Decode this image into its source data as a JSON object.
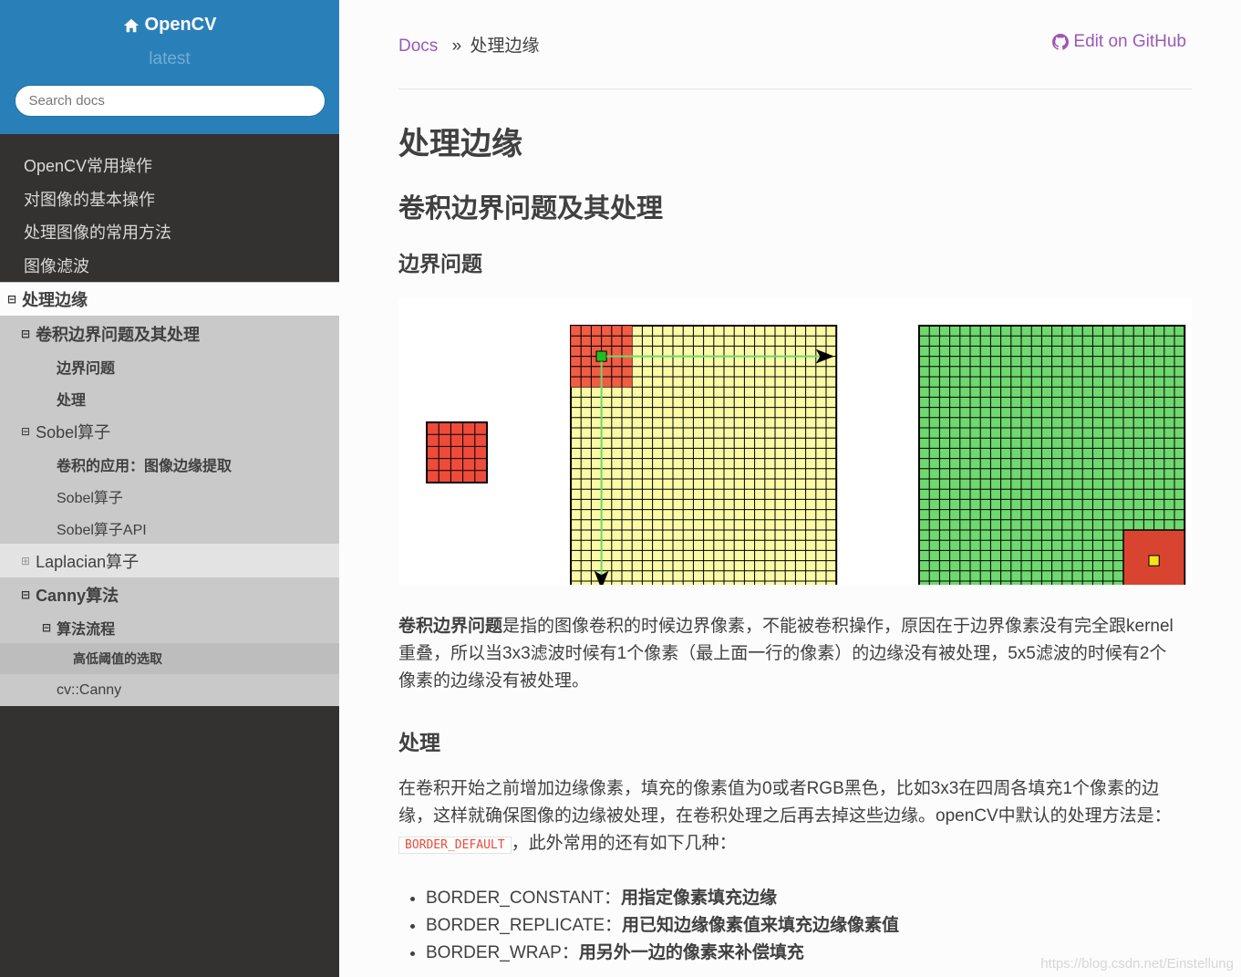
{
  "sidebar": {
    "brand": "OpenCV",
    "version": "latest",
    "search_placeholder": "Search docs",
    "top_items": [
      "OpenCV常用操作",
      "对图像的基本操作",
      "处理图像的常用方法",
      "图像滤波"
    ],
    "current": "处理边缘",
    "sub": {
      "conv": "卷积边界问题及其处理",
      "boundary": "边界问题",
      "handling": "处理",
      "sobel": "Sobel算子",
      "conv_app": "卷积的应用：图像边缘提取",
      "sobel_op": "Sobel算子",
      "sobel_api": "Sobel算子API",
      "laplacian": "Laplacian算子",
      "canny": "Canny算法",
      "algo_flow": "算法流程",
      "threshold": "高低阈值的选取",
      "cv_canny": "cv::Canny"
    }
  },
  "breadcrumb": {
    "docs": "Docs",
    "sep": "»",
    "current": "处理边缘",
    "edit": "Edit on GitHub"
  },
  "content": {
    "title": "处理边缘",
    "h2": "卷积边界问题及其处理",
    "h3_problem": "边界问题",
    "p1_bold": "卷积边界问题",
    "p1_rest": "是指的图像卷积的时候边界像素，不能被卷积操作，原因在于边界像素没有完全跟kernel重叠，所以当3x3滤波时候有1个像素（最上面一行的像素）的边缘没有被处理，5x5滤波的时候有2个像素的边缘没有被处理。",
    "h3_handle": "处理",
    "p2_a": "在卷积开始之前增加边缘像素，填充的像素值为0或者RGB黑色，比如3x3在四周各填充1个像素的边缘，这样就确保图像的边缘被处理，在卷积处理之后再去掉这些边缘。openCV中默认的处理方法是：",
    "p2_code": "BORDER_DEFAULT",
    "p2_b": "，此外常用的还有如下几种：",
    "options": [
      {
        "name": "BORDER_CONSTANT：",
        "desc": "用指定像素填充边缘"
      },
      {
        "name": "BORDER_REPLICATE：",
        "desc": "用已知边缘像素值来填充边缘像素值"
      },
      {
        "name": "BORDER_WRAP：",
        "desc": "用另外一边的像素来补偿填充"
      }
    ]
  },
  "figure_colors": {
    "kernel": "#ee4b3a",
    "image": "#fbfaa6",
    "result": "#6fd86f",
    "arrow": "#6fd86f",
    "border_red": "#d94430"
  },
  "watermark": "https://blog.csdn.net/Einstellung"
}
